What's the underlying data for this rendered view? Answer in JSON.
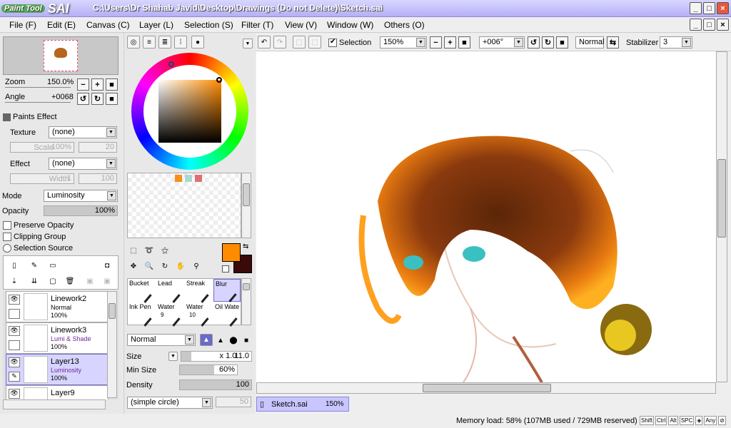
{
  "window": {
    "app_logo_paint": "Paint Tool",
    "app_logo_sai": "SAI",
    "title": "C:\\Users\\Dr Shahab Javid\\Desktop\\Drawings (Do not Delete)\\Sketch.sai",
    "minimize": "_",
    "maximize": "□",
    "close": "×"
  },
  "menu": [
    "File (F)",
    "Edit (E)",
    "Canvas (C)",
    "Layer (L)",
    "Selection (S)",
    "Filter (T)",
    "View (V)",
    "Window (W)",
    "Others (O)"
  ],
  "navigator": {
    "zoom_label": "Zoom",
    "zoom_value": "150.0%",
    "angle_label": "Angle",
    "angle_value": "+0068"
  },
  "paints_effect": {
    "header": "Paints Effect",
    "texture_label": "Texture",
    "texture_value": "(none)",
    "scale_label": "Scale",
    "scale_value": "100%",
    "scale_num": "20",
    "effect_label": "Effect",
    "effect_value": "(none)",
    "width_label": "Width",
    "width_value": "1",
    "width_num": "100"
  },
  "layer_props": {
    "mode_label": "Mode",
    "mode_value": "Luminosity",
    "opacity_label": "Opacity",
    "opacity_value": "100%",
    "opacity_fraction": 1.0,
    "preserve_opacity": "Preserve Opacity",
    "clipping_group": "Clipping Group",
    "selection_source": "Selection Source"
  },
  "layers": [
    {
      "name": "Linework2",
      "mode": "Normal",
      "opacity": "100%",
      "selected": false,
      "mode_color": "#000000"
    },
    {
      "name": "Linework3",
      "mode": "Lumi & Shade",
      "opacity": "100%",
      "selected": false,
      "mode_color": "#6a2a9a"
    },
    {
      "name": "Layer13",
      "mode": "Luminosity",
      "opacity": "100%",
      "selected": true,
      "mode_color": "#6a2a9a"
    },
    {
      "name": "Layer9",
      "mode": "",
      "opacity": "",
      "selected": false,
      "mode_color": "#000000"
    }
  ],
  "color": {
    "primary": "#ff8c00",
    "secondary": "#3a0a0a",
    "swatches": [
      "#f5901e",
      "#a8d8d0",
      "#e07070"
    ]
  },
  "tools": [
    {
      "label": "Bucket",
      "size": ""
    },
    {
      "label": "Lead",
      "size": ""
    },
    {
      "label": "Streak",
      "size": ""
    },
    {
      "label": "Blur",
      "size": ""
    },
    {
      "label": "Ink Pen",
      "size": ""
    },
    {
      "label": "Water",
      "size": "9"
    },
    {
      "label": "Water",
      "size": "10"
    },
    {
      "label": "Oil Wate",
      "size": ""
    }
  ],
  "brush": {
    "blend_mode": "Normal",
    "size_label": "Size",
    "size_mult": "x 1.0",
    "size_value": "11.0",
    "min_size_label": "Min Size",
    "min_size_value": "60%",
    "min_size_fraction": 0.6,
    "density_label": "Density",
    "density_value": "100",
    "density_fraction": 1.0,
    "shape": "(simple circle)",
    "shape_value": "50"
  },
  "toolbar": {
    "selection_label": "Selection",
    "selection_checked": true,
    "zoom": "150%",
    "angle": "+006°",
    "blend": "Normal",
    "stabilizer_label": "Stabilizer",
    "stabilizer_value": "3"
  },
  "document_tab": {
    "name": "Sketch.sai",
    "zoom": "150%"
  },
  "status": {
    "memory": "Memory load: 58% (107MB used / 729MB reserved)",
    "keys": [
      "Shift",
      "Ctrl",
      "Alt",
      "SPC",
      "◈",
      "Any",
      "⊘"
    ]
  }
}
